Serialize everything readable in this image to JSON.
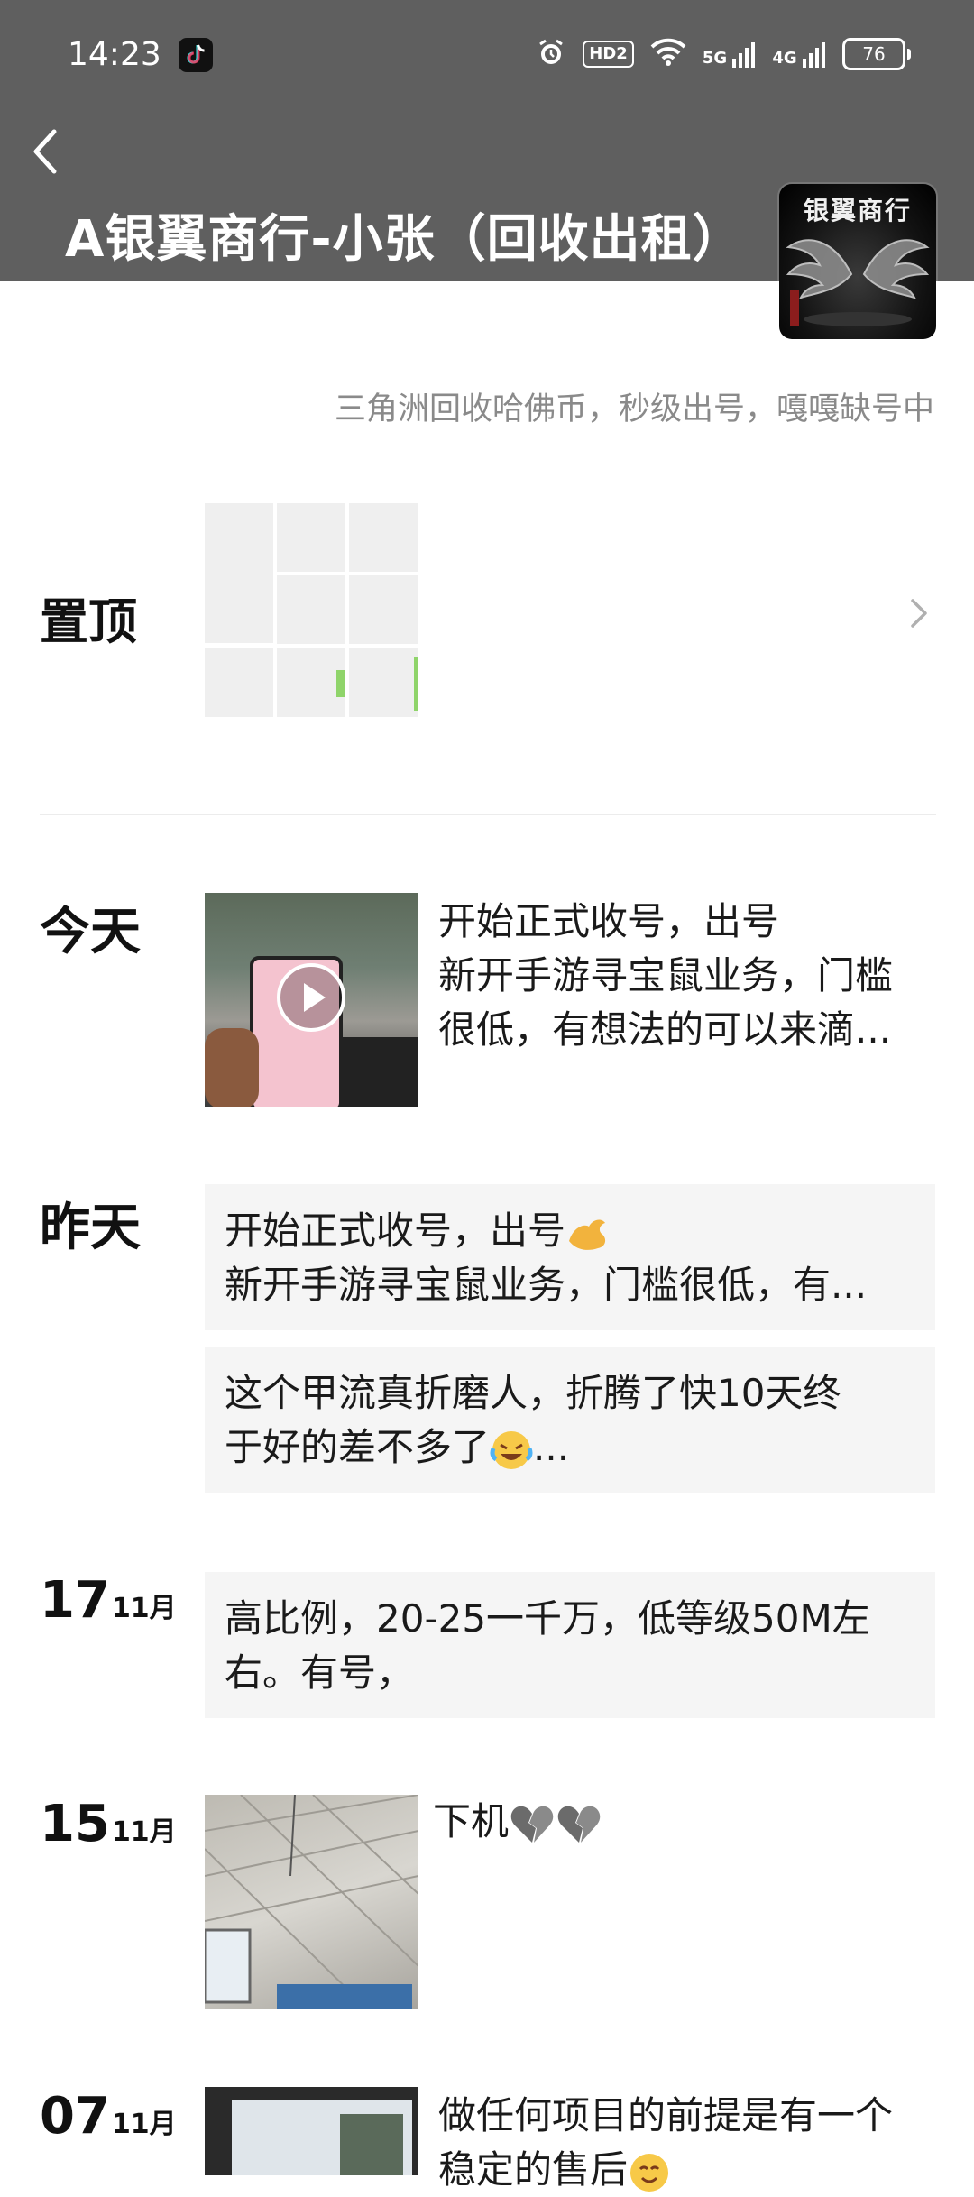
{
  "status_bar": {
    "time": "14:23",
    "hd_label": "HD2",
    "net1_label": "5G",
    "net2_label": "4G",
    "battery_level": "76"
  },
  "header": {
    "title": "A银翼商行-小张（回收出租）",
    "avatar_text": "银翼商行"
  },
  "signature": "三角洲回收哈佛币，秒级出号，嘎嘎缺号中",
  "pinned": {
    "label": "置顶"
  },
  "timeline": [
    {
      "date_label": "今天",
      "lines": [
        "开始正式收号，出号",
        "新开手游寻宝鼠业务，门槛",
        "很低，有想法的可以来滴..."
      ]
    },
    {
      "date_label": "昨天",
      "bubbles": [
        {
          "lines": [
            "开始正式收号，出号",
            "新开手游寻宝鼠业务，门槛很低，有..."
          ]
        },
        {
          "lines": [
            "这个甲流真折磨人，折腾了快10天终",
            "于好的差不多了",
            "..."
          ]
        }
      ]
    },
    {
      "day": "17",
      "month": "11月",
      "bubbles": [
        {
          "lines": [
            "高比例，20-25一千万，低等级50M左",
            "右。有号，"
          ]
        }
      ]
    },
    {
      "day": "15",
      "month": "11月",
      "lines": [
        "下机"
      ]
    },
    {
      "day": "07",
      "month": "11月",
      "lines": [
        "做任何项目的前提是有一个",
        "稳定的售后"
      ]
    }
  ],
  "icons": {
    "back": "chevron-left-icon",
    "pinned_more": "chevron-right-icon",
    "play": "play-icon"
  }
}
